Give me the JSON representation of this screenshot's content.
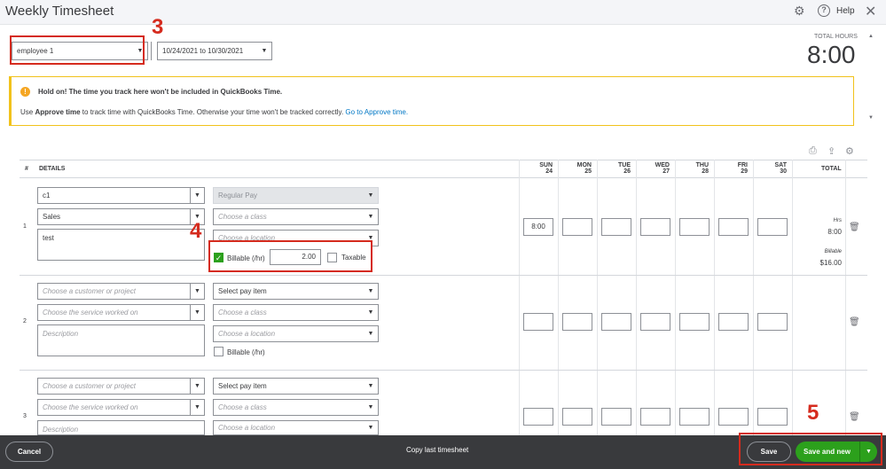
{
  "window": {
    "title": "Weekly Timesheet",
    "help_label": "Help"
  },
  "icons": {
    "settings": "⚙",
    "help": "?",
    "close": "✕",
    "print": "⎙",
    "export": "⇪",
    "gear": "⚙",
    "trash": "🗑",
    "caret": "▼",
    "warning": "!",
    "check": "✓"
  },
  "filters": {
    "employee": "employee 1",
    "date_range": "10/24/2021 to 10/30/2021"
  },
  "total_hours": {
    "label": "TOTAL HOURS",
    "value": "8:00"
  },
  "notice": {
    "title": "Hold on! The time you track here won't be included in QuickBooks Time.",
    "line_prefix": "Use ",
    "line_bold": "Approve time",
    "line_middle": " to track time with QuickBooks Time. Otherwise your time won't be tracked correctly. ",
    "link": "Go to Approve time."
  },
  "table": {
    "col_num": "#",
    "col_details": "DETAILS",
    "col_total": "TOTAL",
    "days": [
      {
        "name": "SUN",
        "date": "24"
      },
      {
        "name": "MON",
        "date": "25"
      },
      {
        "name": "TUE",
        "date": "26"
      },
      {
        "name": "WED",
        "date": "27"
      },
      {
        "name": "THU",
        "date": "28"
      },
      {
        "name": "FRI",
        "date": "29"
      },
      {
        "name": "SAT",
        "date": "30"
      }
    ]
  },
  "rows": [
    {
      "num": "1",
      "customer": "c1",
      "service": "Sales",
      "description": "test",
      "pay_item": "Regular Pay",
      "class_placeholder": "Choose a class",
      "location_placeholder": "Choose a location",
      "billable_label": "Billable (/hr)",
      "billable_checked": true,
      "rate": "2.00",
      "taxable_label": "Taxable",
      "sun": "8:00",
      "hrs_label": "Hrs",
      "hrs_value": "8:00",
      "billable_total_label": "Billable",
      "billable_total_value": "$16.00"
    },
    {
      "num": "2",
      "customer_placeholder": "Choose a customer or project",
      "service_placeholder": "Choose the service worked on",
      "description_placeholder": "Description",
      "pay_item": "Select pay item",
      "class_placeholder": "Choose a class",
      "location_placeholder": "Choose a location",
      "billable_label": "Billable (/hr)"
    },
    {
      "num": "3",
      "customer_placeholder": "Choose a customer or project",
      "service_placeholder": "Choose the service worked on",
      "description_placeholder": "Description",
      "pay_item": "Select pay item",
      "class_placeholder": "Choose a class",
      "location_placeholder": "Choose a location"
    }
  ],
  "annotations": {
    "n3": "3",
    "n4": "4",
    "n5": "5"
  },
  "footer": {
    "cancel": "Cancel",
    "copy_last": "Copy last timesheet",
    "save": "Save",
    "save_and_new": "Save and new"
  }
}
